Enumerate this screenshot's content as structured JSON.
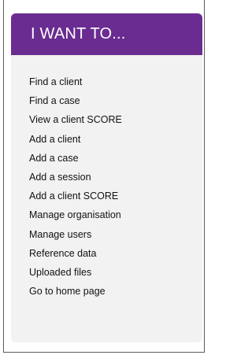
{
  "panel": {
    "title": "I WANT TO...",
    "header_color": "#6a2c91",
    "links": [
      "Find a client",
      "Find a case",
      "View a client SCORE",
      "Add a client",
      "Add a case",
      "Add a session",
      "Add a client SCORE",
      "Manage organisation",
      "Manage users",
      "Reference data",
      "Uploaded files",
      "Go to home page"
    ]
  }
}
